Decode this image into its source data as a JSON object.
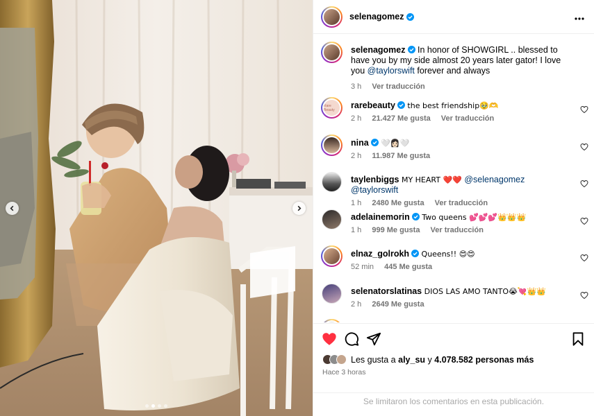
{
  "post": {
    "author": "selenagomez",
    "more_icon": "three-dots-icon",
    "caption": {
      "user": "selenagomez",
      "text_before": "In honor of SHOWGIRL .. blessed to have you by my side almost 20 years later gator! I love you",
      "mention": "@taylorswift",
      "text_after": "forever and always",
      "time": "3 h",
      "translate": "Ver traducción"
    }
  },
  "comments": [
    {
      "user": "rarebeauty",
      "verified": true,
      "text": "the best friendship🥹🫶",
      "time": "2 h",
      "likes": "21.427 Me gusta",
      "translate": "Ver traducción",
      "avatar_color": "#f4d9cf"
    },
    {
      "user": "nina",
      "verified": true,
      "text": "🤍👩🏻🤍",
      "time": "2 h",
      "likes": "11.987 Me gusta",
      "translate": "",
      "avatar_color": "#3a2a24"
    },
    {
      "user": "taylenbiggs",
      "verified": false,
      "text": "MY HEART ❤️❤️",
      "mention": "@selenagomez @taylorswift",
      "time": "1 h",
      "likes": "2480 Me gusta",
      "translate": "Ver traducción",
      "avatar_color": "#e9e9e9"
    },
    {
      "user": "adelainemorin",
      "verified": true,
      "text": "Two queens 💕💕💕👑👑👑",
      "time": "1 h",
      "likes": "999 Me gusta",
      "translate": "Ver traducción",
      "avatar_color": "#2d2a2a"
    },
    {
      "user": "elnaz_golrokh",
      "verified": true,
      "text": "Queens!! 😍😍",
      "time": "52 min",
      "likes": "445 Me gusta",
      "translate": "",
      "avatar_color": "#b58a6a"
    },
    {
      "user": "selenatorslatinas",
      "verified": false,
      "text": "DIOS LAS AMO TANTO😭💘👑👑",
      "time": "2 h",
      "likes": "2649 Me gusta",
      "translate": "",
      "avatar_color": "#46407a"
    }
  ],
  "actions": {
    "like_icon": "heart-filled-icon",
    "comment_icon": "comment-icon",
    "share_icon": "share-icon",
    "save_icon": "bookmark-icon",
    "likes_prefix": "Les gusta a",
    "likes_user": "aly_su",
    "likes_middle": "y",
    "likes_count": "4.078.582 personas más",
    "time_ago": "Hace 3 horas",
    "comments_limited": "Se limitaron los comentarios en esta publicación."
  },
  "carousel": {
    "slides": 4,
    "active": 1
  },
  "colors": {
    "like_red": "#ff3040",
    "verified_blue": "#0095f6",
    "mention_blue": "#00376b",
    "muted": "#737373"
  }
}
